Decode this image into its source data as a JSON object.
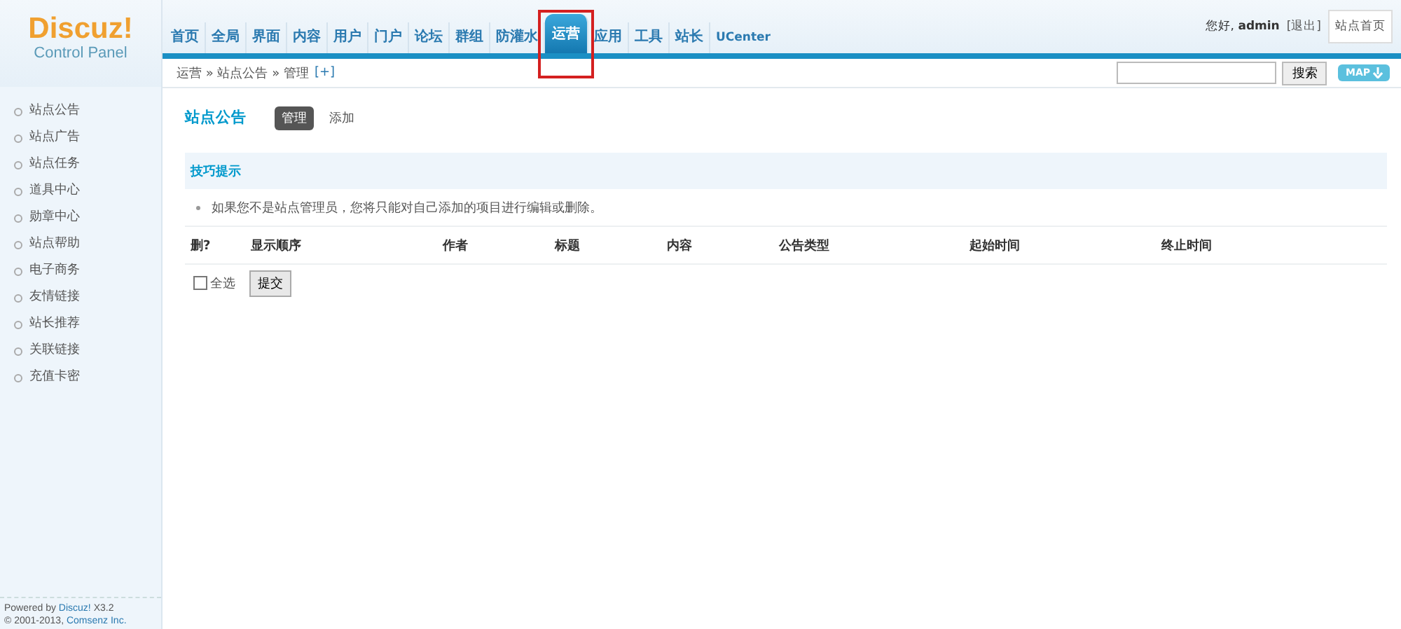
{
  "logo": {
    "title": "Discuz!",
    "subtitle": "Control Panel"
  },
  "nav": [
    {
      "label": "首页",
      "selected": false
    },
    {
      "label": "全局",
      "selected": false
    },
    {
      "label": "界面",
      "selected": false
    },
    {
      "label": "内容",
      "selected": false
    },
    {
      "label": "用户",
      "selected": false
    },
    {
      "label": "门户",
      "selected": false
    },
    {
      "label": "论坛",
      "selected": false
    },
    {
      "label": "群组",
      "selected": false
    },
    {
      "label": "防灌水",
      "selected": false
    },
    {
      "label": "运营",
      "selected": true
    },
    {
      "label": "应用",
      "selected": false
    },
    {
      "label": "工具",
      "selected": false
    },
    {
      "label": "站长",
      "selected": false
    },
    {
      "label": "UCenter",
      "selected": false
    }
  ],
  "user": {
    "greeting": "您好,",
    "name": "admin",
    "logout": "[退出]",
    "home_button": "站点首页"
  },
  "breadcrumb": {
    "path": "运营 » 站点公告 » 管理",
    "add": "[+]"
  },
  "search": {
    "button": "搜索",
    "map": "MAP"
  },
  "sidebar": {
    "items": [
      {
        "label": "站点公告",
        "selected": false
      },
      {
        "label": "站点广告",
        "selected": false
      },
      {
        "label": "站点任务",
        "selected": false
      },
      {
        "label": "道具中心",
        "selected": false
      },
      {
        "label": "勋章中心",
        "selected": false
      },
      {
        "label": "站点帮助",
        "selected": false
      },
      {
        "label": "电子商务",
        "selected": false
      },
      {
        "label": "友情链接",
        "selected": false
      },
      {
        "label": "站长推荐",
        "selected": false
      },
      {
        "label": "关联链接",
        "selected": false
      },
      {
        "label": "充值卡密",
        "selected": false
      }
    ],
    "footer": {
      "powered": "Powered by",
      "product": "Discuz!",
      "version": "X3.2",
      "copyright": "© 2001-2013,",
      "company": "Comsenz Inc."
    }
  },
  "page": {
    "title": "站点公告",
    "tabs": [
      {
        "label": "管理",
        "selected": true
      },
      {
        "label": "添加",
        "selected": false
      }
    ]
  },
  "tips": {
    "title": "技巧提示",
    "items": [
      "如果您不是站点管理员，您将只能对自己添加的项目进行编辑或删除。"
    ]
  },
  "table": {
    "columns": [
      "删?",
      "显示顺序",
      "作者",
      "标题",
      "内容",
      "公告类型",
      "起始时间",
      "终止时间"
    ]
  },
  "form": {
    "select_all": {
      "label": "全选",
      "checked": false
    },
    "submit": "提交"
  }
}
